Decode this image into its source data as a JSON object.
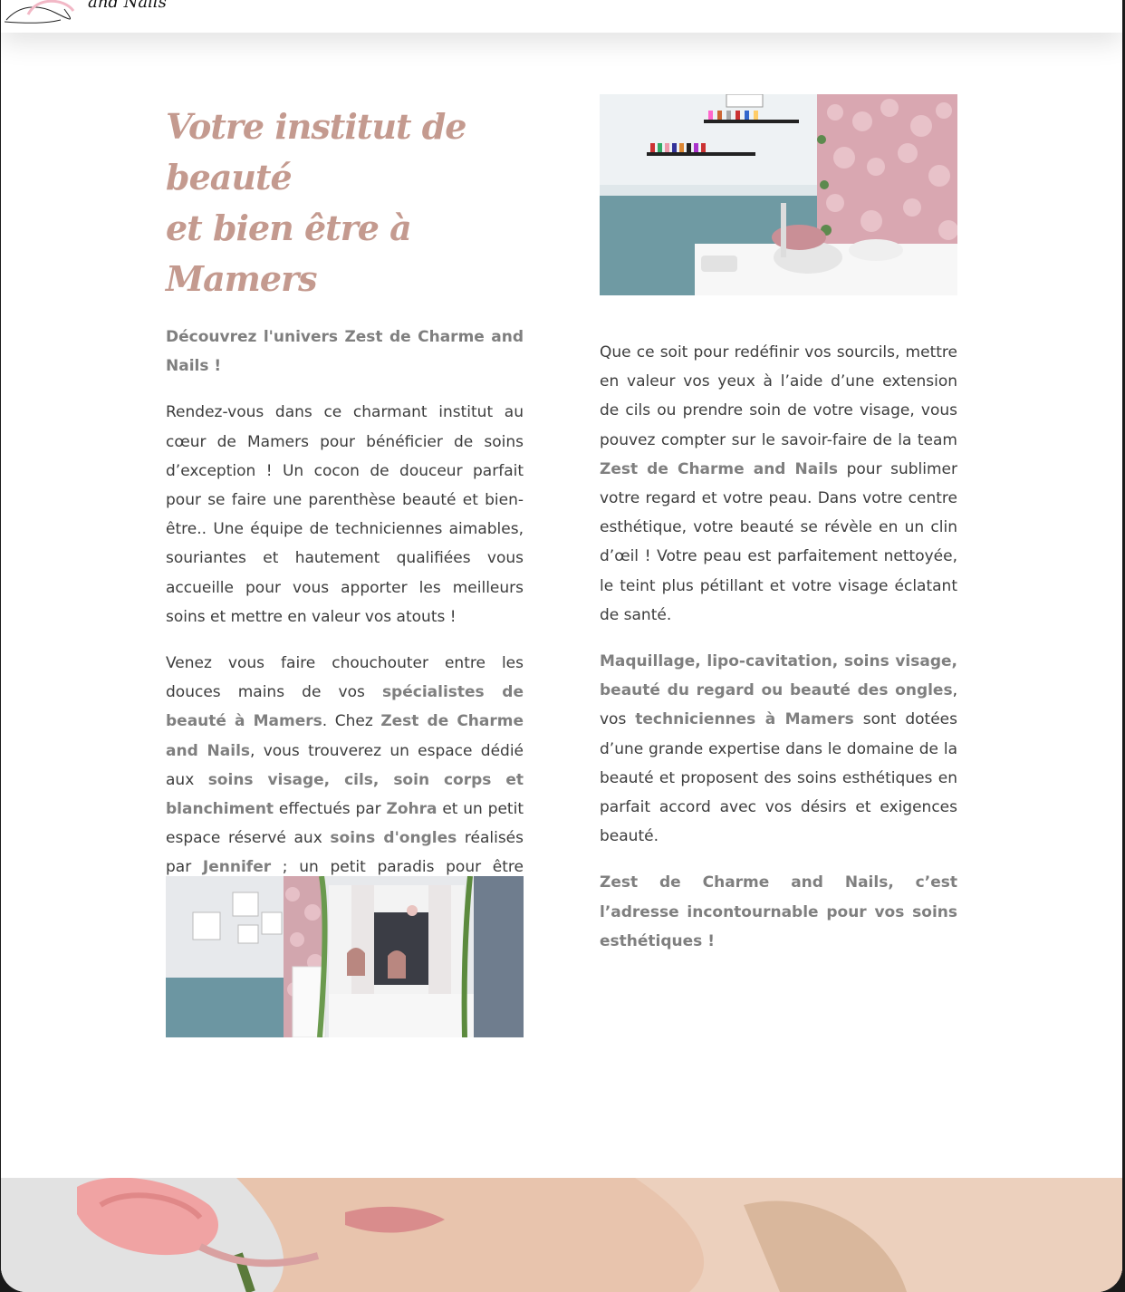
{
  "header": {
    "logo_text": "and Nails"
  },
  "left": {
    "title_line1": "Votre institut de beauté",
    "title_line2": "et bien être à Mamers",
    "intro": "Découvrez l'univers Zest de Charme and Nails !",
    "p1": "Rendez-vous dans ce charmant institut au cœur de Mamers pour bénéficier de soins d’exception ! Un cocon de douceur parfait pour se faire une parenthèse beauté et bien-être.. Une équipe de techniciennes aimables, souriantes et hautement qualifiées vous accueille pour vous apporter les meilleurs soins et mettre en valeur vos atouts !",
    "p2": {
      "t1": "Venez vous faire chouchouter entre les douces mains de vos ",
      "b1": "spécialistes de beauté à Mamers",
      "t2": ". Chez ",
      "b2": "Zest de Charme and Nails",
      "t3": ", vous trouverez un espace dédié aux ",
      "b3": "soins visage, cils, soin corps et blanchiment",
      "t4": " effectués par ",
      "b4": "Zohra",
      "t5": " et un petit espace réservé aux ",
      "b5": "soins d'ongles",
      "t6": " réalisés par ",
      "b6": "Jennifer",
      "t7": " ; un petit paradis pour être chouchouté de la tête aux pieds !"
    }
  },
  "right": {
    "p1": {
      "t1": "Que ce soit pour redéfinir vos sourcils, mettre en valeur vos yeux à l’aide d’une extension de cils ou prendre soin de votre visage, vous pouvez compter sur le savoir-faire de la team ",
      "b1": "Zest de Charme and Nails",
      "t2": " pour sublimer votre regard et votre peau. Dans votre centre esthétique, votre beauté se révèle en un clin d’œil ! Votre peau est parfaitement nettoyée, le teint plus pétillant et votre visage éclatant de santé."
    },
    "p2": {
      "b1": "Maquillage, lipo-cavitation, soins visage, beauté du regard ou beauté des ongles",
      "t1": ", vos ",
      "b2": "techniciennes à Mamers",
      "t2": " sont dotées d’une grande expertise dans le domaine de la beauté et proposent des soins esthétiques en parfait accord avec vos désirs et exigences beauté."
    },
    "p3": "Zest de Charme and Nails, c’est l’adresse incontournable pour vos soins esthétiques !"
  },
  "images": {
    "photo1": "nail-station-flower-wall-photo",
    "photo2": "institute-reception-room-photo",
    "hero": "woman-with-pink-rose-photo"
  },
  "colors": {
    "title": "#c49a8f",
    "bold_text": "#7f7f7f",
    "body_text": "#3d3d3d"
  }
}
